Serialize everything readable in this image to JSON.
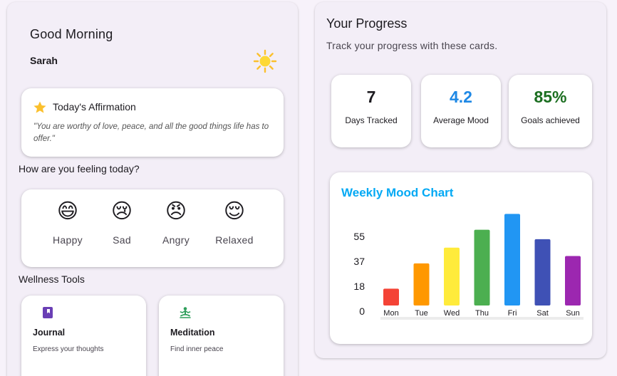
{
  "header": {
    "greeting": "Good Morning",
    "user_name": "Sarah",
    "weather_icon": "sun-icon"
  },
  "affirmation": {
    "icon": "star-icon",
    "title": "Today's Affirmation",
    "text": "\"You are worthy of love, peace, and all the good things life has to offer.\""
  },
  "mood_check": {
    "heading": "How are you feeling today?",
    "options": [
      {
        "emoji": "😄",
        "label": "Happy"
      },
      {
        "emoji": "😢",
        "label": "Sad"
      },
      {
        "emoji": "😠",
        "label": "Angry"
      },
      {
        "emoji": "😌",
        "label": "Relaxed"
      }
    ]
  },
  "wellness_tools": {
    "heading": "Wellness Tools",
    "items": [
      {
        "icon": "book-icon",
        "title": "Journal",
        "description": "Express your thoughts",
        "color": "#6a3fb5"
      },
      {
        "icon": "meditation-icon",
        "title": "Meditation",
        "description": "Find inner peace",
        "color": "#2e9e5b"
      }
    ]
  },
  "progress": {
    "title": "Your Progress",
    "subtitle": "Track your progress with these cards.",
    "stats": [
      {
        "value": "7",
        "label": "Days Tracked",
        "color": "#1d1b20"
      },
      {
        "value": "4.2",
        "label": "Average Mood",
        "color": "#1e88e5"
      },
      {
        "value": "85%",
        "label": "Goals achieved",
        "color": "#1b6e20"
      }
    ]
  },
  "chart_data": {
    "type": "bar",
    "title": "Weekly Mood Chart",
    "categories": [
      "Mon",
      "Tue",
      "Wed",
      "Thu",
      "Fri",
      "Sat",
      "Sun"
    ],
    "values": [
      16,
      40,
      55,
      72,
      87,
      63,
      47
    ],
    "colors": [
      "#f44336",
      "#ff9800",
      "#ffeb3b",
      "#4caf50",
      "#2196f3",
      "#3f51b5",
      "#9c27b0"
    ],
    "yticks": [
      "0",
      "18",
      "37",
      "55"
    ],
    "ytick_values": [
      0,
      18,
      37,
      55
    ],
    "ylim": [
      0,
      90
    ],
    "xlabel": "",
    "ylabel": "",
    "grid": false
  }
}
